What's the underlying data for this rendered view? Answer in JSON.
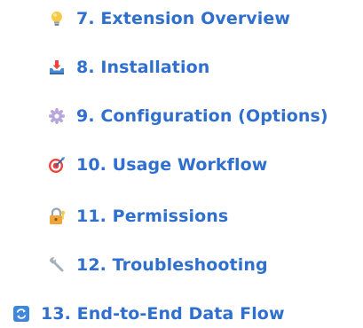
{
  "toc": {
    "items": [
      {
        "label": "7. Extension Overview",
        "icon": "lightbulb-icon"
      },
      {
        "label": "8. Installation",
        "icon": "inbox-tray-icon"
      },
      {
        "label": "9. Configuration (Options)",
        "icon": "gear-icon"
      },
      {
        "label": "10. Usage Workflow",
        "icon": "direct-hit-target-icon"
      },
      {
        "label": "11. Permissions",
        "icon": "lock-with-key-icon"
      },
      {
        "label": "12. Troubleshooting",
        "icon": "wrench-icon"
      },
      {
        "label": "13. End-to-End Data Flow",
        "icon": "repeat-arrows-icon"
      }
    ]
  },
  "colors": {
    "link": "#2f6fcd"
  }
}
